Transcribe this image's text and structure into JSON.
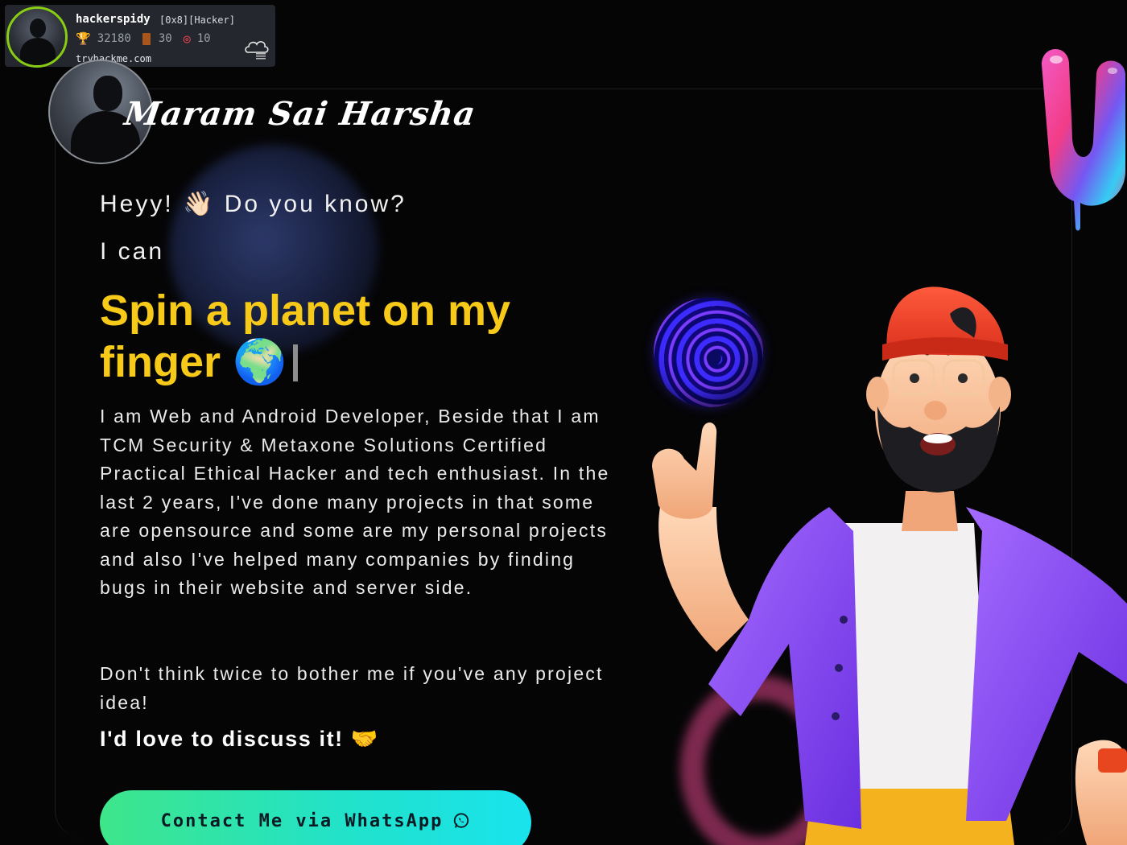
{
  "thm_badge": {
    "username": "hackerspidy",
    "rank": "[0x8][Hacker]",
    "points": "32180",
    "rooms": "30",
    "badges": "10",
    "site": "tryhackme.com",
    "icons": [
      "trophy-icon",
      "door-icon",
      "target-icon",
      "cloud-icon"
    ]
  },
  "header": {
    "signature": "Maram Sai Harsha"
  },
  "hero": {
    "greeting": "Heyy! 👋🏻 Do you know?",
    "lead": "I can",
    "headline": "Spin a planet on my finger 🌍",
    "bio": "I am Web and Android Developer, Beside that I am TCM Security & Metaxone Solutions Certified Practical Ethical Hacker and tech enthusiast. In the last 2 years, I've done many projects in that some are opensource and some are my personal projects and also I've helped many companies by finding bugs in their website and server side.",
    "invite": "Don't think twice to bother me if you've any project idea!",
    "discuss": "I'd love to discuss it! 🤝",
    "cta_label": "Contact Me via WhatsApp"
  },
  "colors": {
    "background": "#050506",
    "headline": "#f7c918",
    "cta_gradient_start": "#3ee58a",
    "cta_gradient_end": "#19e3ee",
    "thm_accent": "#88cc14"
  }
}
